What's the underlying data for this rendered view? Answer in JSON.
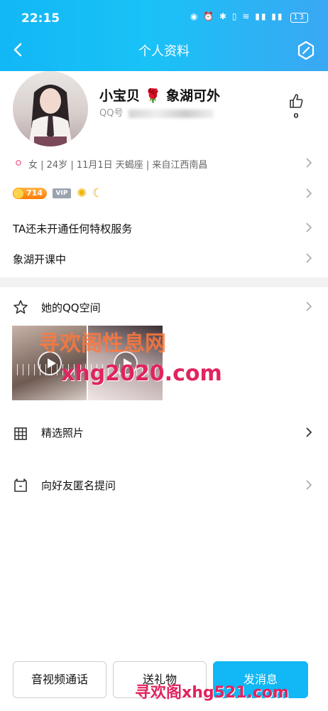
{
  "status_bar": {
    "time": "22:15",
    "battery": "13"
  },
  "header": {
    "title": "个人资料"
  },
  "profile": {
    "name": "小宝贝",
    "name_emoji": "🌹",
    "name_suffix": "象湖可外",
    "qq_label": "QQ号",
    "info_line": "女 | 24岁 | 11月1日 天蝎座 | 来自江西南昌",
    "like_count": "0"
  },
  "badges": {
    "level": "714",
    "vip": "VIP"
  },
  "menu": {
    "privileges": "TA还未开通任何特权服务",
    "course": "象湖开课中",
    "qzone": "她的QQ空间",
    "photos": "精选照片",
    "anonymous": "向好友匿名提问"
  },
  "watermarks": {
    "top": "寻欢阁性息网",
    "middle": "xhg2020.com",
    "bottom": "寻欢阁xhg521.com"
  },
  "footer": {
    "call": "音视频通话",
    "gift": "送礼物",
    "message": "发消息"
  },
  "colors": {
    "accent": "#12b7f5"
  }
}
